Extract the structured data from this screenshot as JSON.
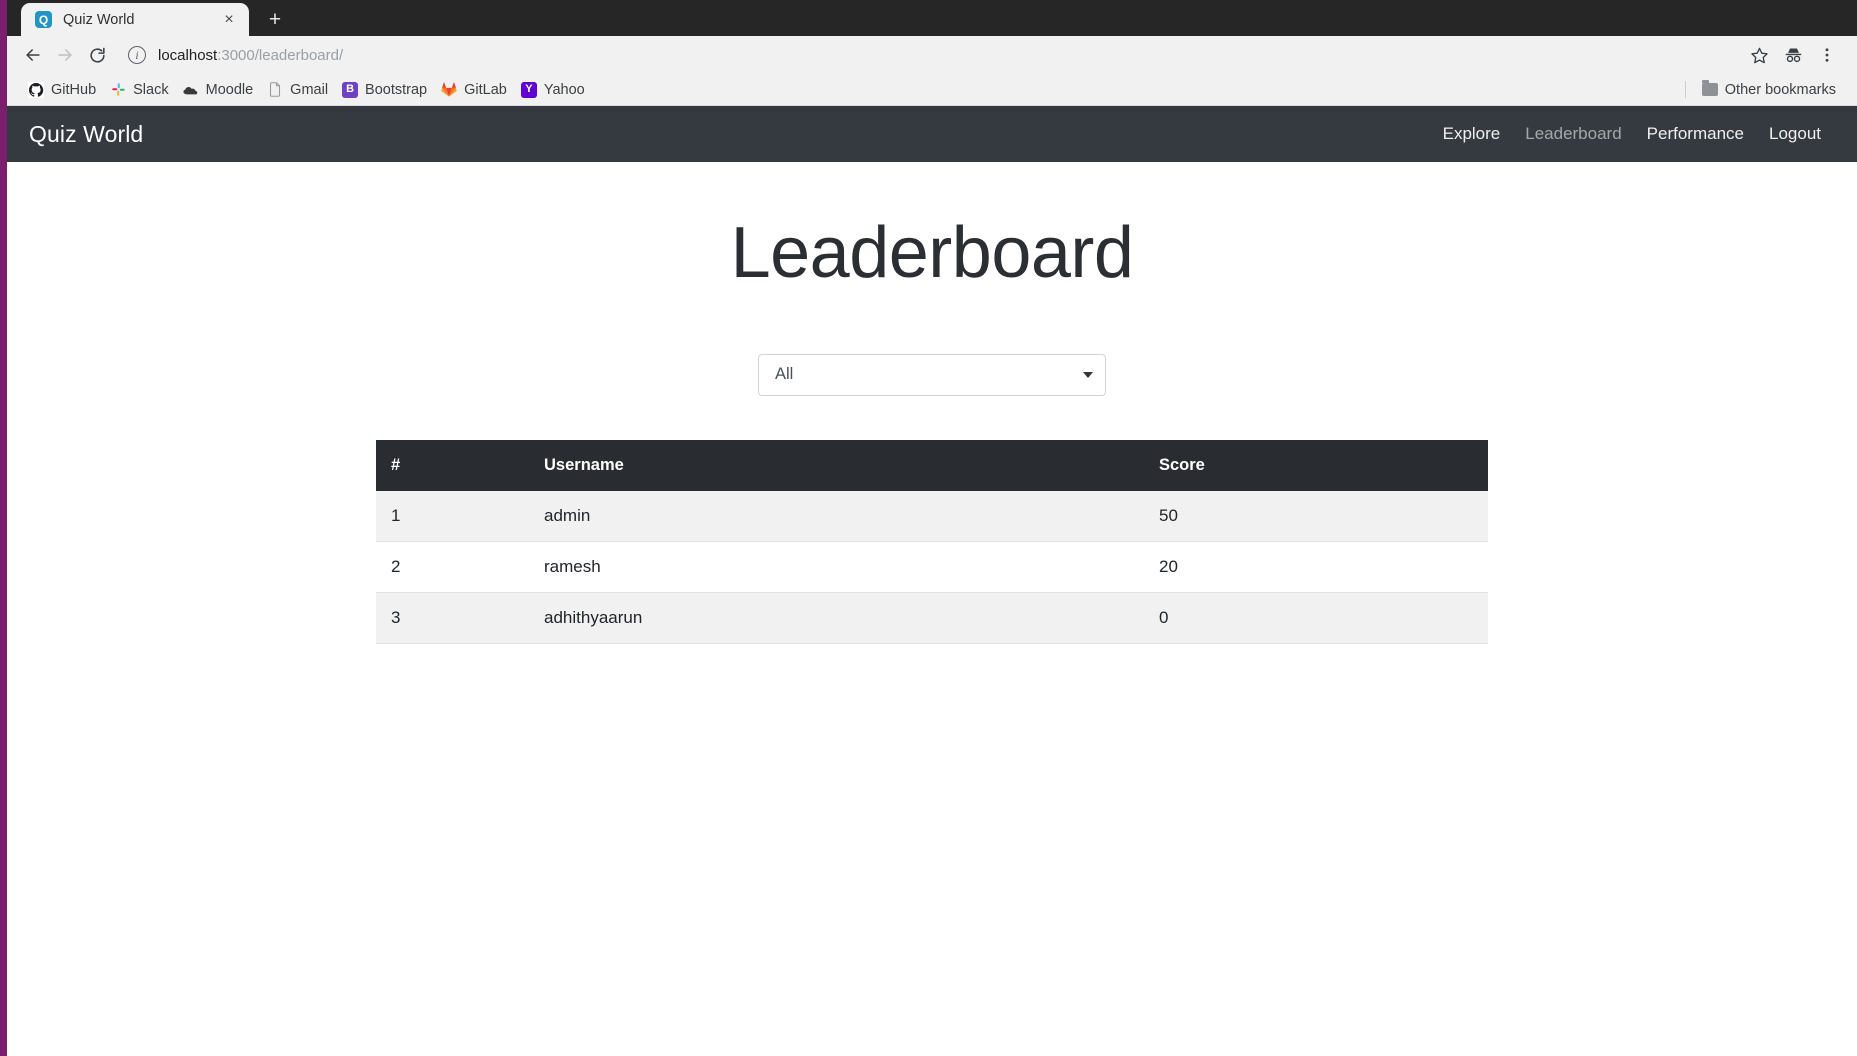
{
  "browser": {
    "tab": {
      "title": "Quiz World",
      "favicon_letter": "Q",
      "favicon_name": "quiz-world-favicon",
      "close_glyph": "×"
    },
    "new_tab_glyph": "+",
    "toolbar": {
      "back_name": "back-button",
      "forward_name": "forward-button",
      "reload_name": "reload-button",
      "site_info_glyph": "i",
      "url_host": "localhost",
      "url_path": ":3000/leaderboard/",
      "url_full": "localhost:3000/leaderboard/",
      "bookmark_star_name": "bookmark-star-icon",
      "incognito_name": "incognito-icon",
      "menu_name": "browser-menu-icon"
    },
    "bookmarks": [
      {
        "label": "GitHub",
        "icon": "github-icon",
        "glyph": "●",
        "cls": "ico-github"
      },
      {
        "label": "Slack",
        "icon": "slack-icon",
        "glyph": "✽",
        "cls": "ico-slack"
      },
      {
        "label": "Moodle",
        "icon": "moodle-icon",
        "glyph": "☁",
        "cls": "ico-moodle"
      },
      {
        "label": "Gmail",
        "icon": "gmail-icon",
        "glyph": "✉",
        "cls": "ico-gmail"
      },
      {
        "label": "Bootstrap",
        "icon": "bootstrap-icon",
        "glyph": "B",
        "cls": "ico-boot"
      },
      {
        "label": "GitLab",
        "icon": "gitlab-icon",
        "glyph": "▲",
        "cls": "ico-gitlab"
      },
      {
        "label": "Yahoo",
        "icon": "yahoo-icon",
        "glyph": "Y",
        "cls": "ico-yahoo"
      }
    ],
    "other_bookmarks_label": "Other bookmarks"
  },
  "navbar": {
    "brand": "Quiz World",
    "links": [
      {
        "label": "Explore",
        "active": false
      },
      {
        "label": "Leaderboard",
        "active": true
      },
      {
        "label": "Performance",
        "active": false
      },
      {
        "label": "Logout",
        "active": false
      }
    ]
  },
  "main": {
    "title": "Leaderboard",
    "filter": {
      "selected": "All",
      "options": [
        "All"
      ]
    },
    "table": {
      "columns": [
        "#",
        "Username",
        "Score"
      ],
      "rows": [
        {
          "rank": "1",
          "username": "admin",
          "score": "50"
        },
        {
          "rank": "2",
          "username": "ramesh",
          "score": "20"
        },
        {
          "rank": "3",
          "username": "adhithyaarun",
          "score": "0"
        }
      ]
    }
  },
  "colors": {
    "navbar_bg": "#343a40",
    "table_head_bg": "#292d31",
    "window_border": "#7b1e6e",
    "stripe_row_bg": "#f1f1f1",
    "favicon_bg": "#2196c4"
  }
}
